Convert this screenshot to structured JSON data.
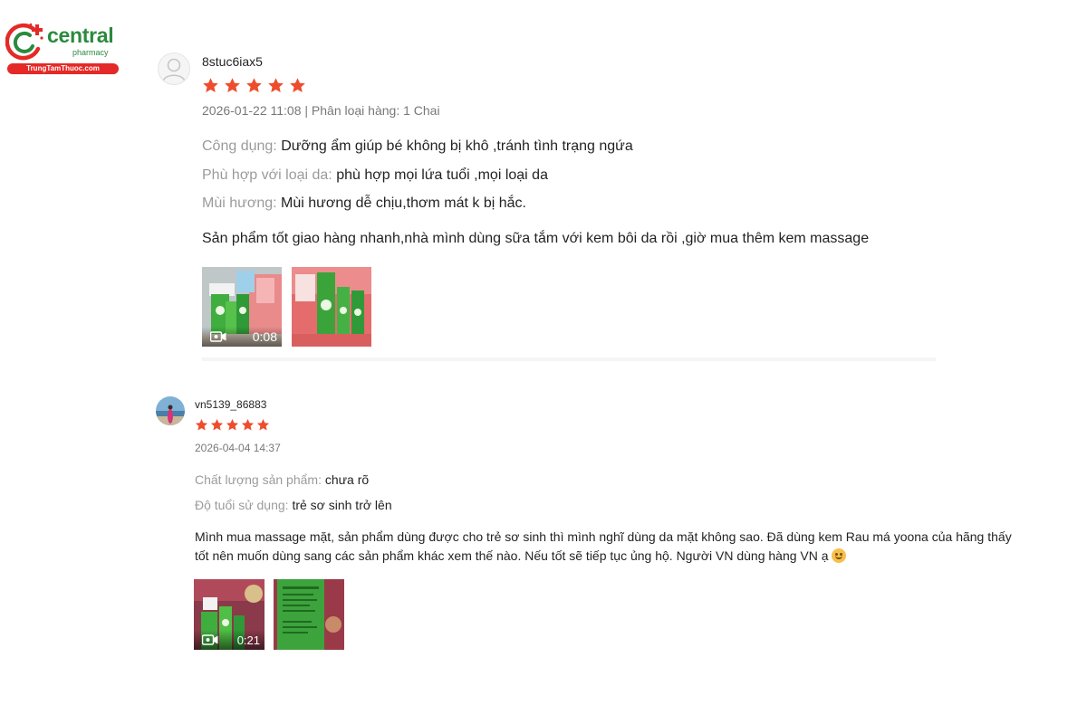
{
  "logo": {
    "word": "central",
    "sub": "pharmacy",
    "tagline": "TrungTamThuoc.com",
    "colors": {
      "green": "#2b8a3e",
      "red": "#e42a26"
    }
  },
  "rating_color": "#ee4d2d",
  "reviews": [
    {
      "username": "8stuc6iax5",
      "avatar": "default-avatar-icon",
      "stars": 5,
      "meta": "2026-01-22 11:08 | Phân loại hàng: 1 Chai",
      "attributes": [
        {
          "label": "Công dụng:",
          "value": "Dưỡng ẩm giúp bé không bị khô ,tránh tình trạng ngứa"
        },
        {
          "label": "Phù hợp với loại da:",
          "value": "phù hợp mọi lứa tuổi ,mọi loại da"
        },
        {
          "label": "Mùi hương:",
          "value": "Mùi hương dễ chịu,thơm mát k bị hắc."
        }
      ],
      "comment": "Sản phẩm tốt giao hàng nhanh,nhà mình dùng sữa tắm với kem bôi da rồi ,giờ mua thêm kem massage",
      "media": [
        {
          "type": "video",
          "duration": "0:08"
        },
        {
          "type": "image"
        }
      ]
    },
    {
      "username": "vn5139_86883",
      "avatar": "user-photo-avatar",
      "stars": 5,
      "meta": "2026-04-04 14:37",
      "attributes": [
        {
          "label": "Chất lượng sản phẩm:",
          "value": "chưa rõ"
        },
        {
          "label": "Độ tuổi sử dụng:",
          "value": "trẻ sơ sinh trở lên"
        }
      ],
      "comment": "Mình mua massage mặt, sản phẩm dùng được cho trẻ sơ sinh thì mình nghĩ dùng da mặt không sao. Đã dùng kem Rau má yoona của hãng thấy tốt nên muốn dùng sang các sản phẩm khác xem thế nào. Nếu tốt sẽ tiếp tục ủng hộ. Người VN dùng hàng VN ạ",
      "comment_emoji": "smiling-face-emoji",
      "media": [
        {
          "type": "video",
          "duration": "0:21"
        },
        {
          "type": "image"
        }
      ]
    }
  ]
}
